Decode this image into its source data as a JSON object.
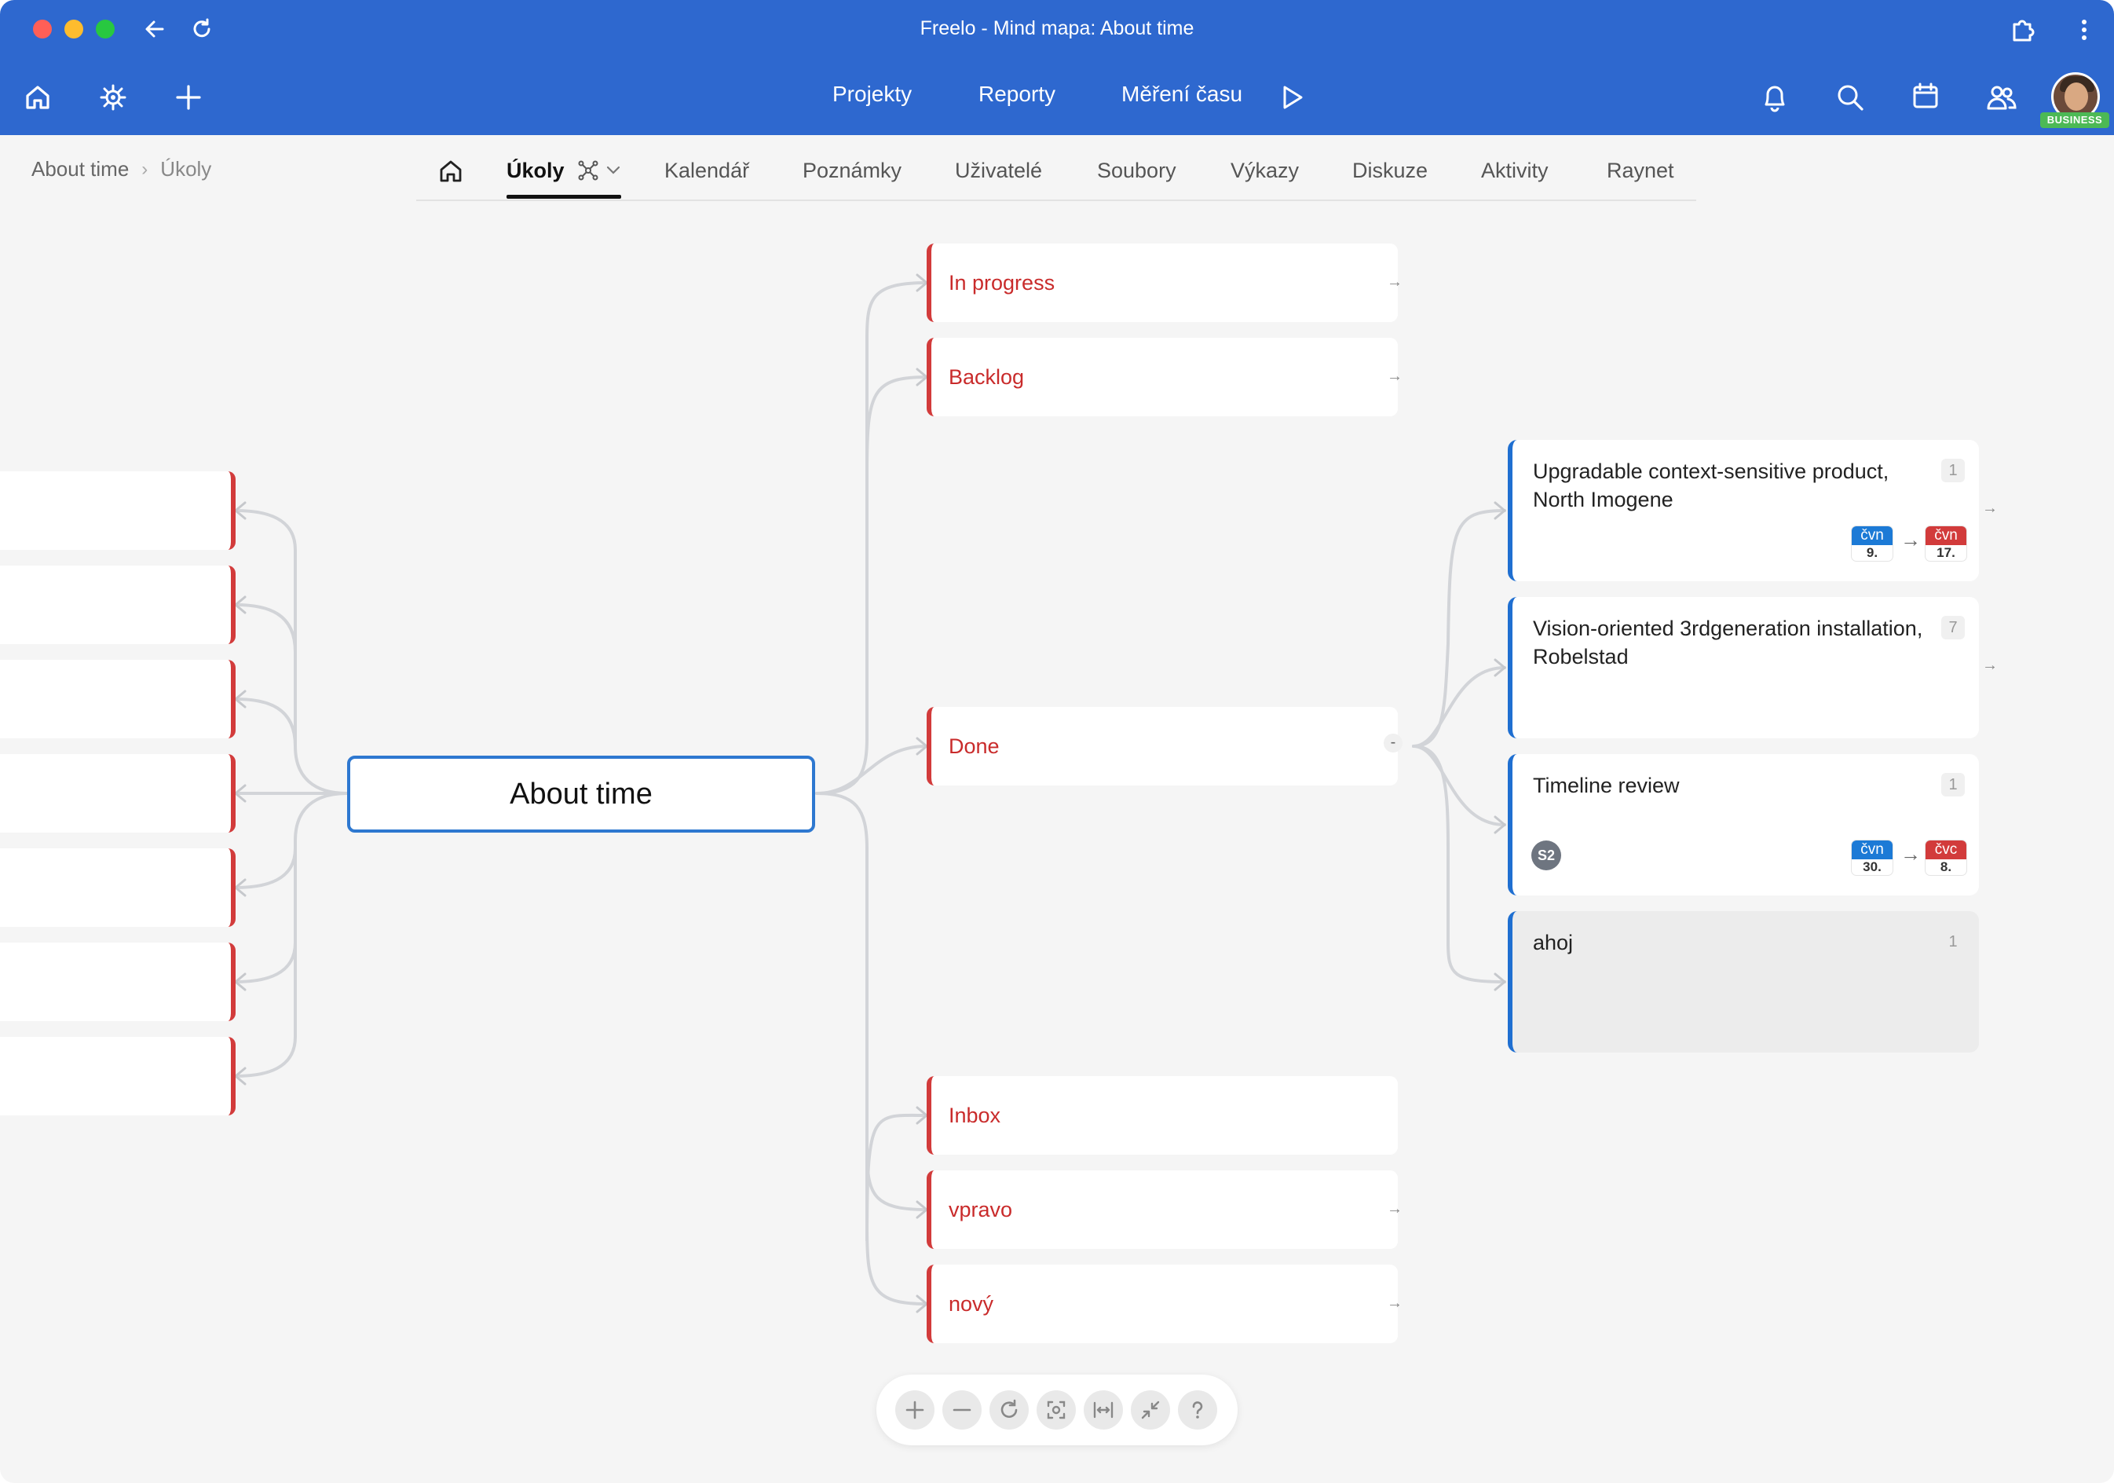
{
  "window": {
    "title": "Freelo - Mind mapa: About time"
  },
  "nav": {
    "projects": "Projekty",
    "reports": "Reporty",
    "time_tracking": "Měření času",
    "plan_badge": "BUSINESS"
  },
  "breadcrumb": {
    "project": "About time",
    "separator": "›",
    "current": "Úkoly"
  },
  "tabs": {
    "tasks": "Úkoly",
    "calendar": "Kalendář",
    "notes": "Poznámky",
    "users": "Uživatelé",
    "files": "Soubory",
    "timesheets": "Výkazy",
    "discussion": "Diskuze",
    "activities": "Aktivity",
    "raynet": "Raynet"
  },
  "mindmap": {
    "root": "About time",
    "columns": {
      "in_progress": "In progress",
      "backlog": "Backlog",
      "done": "Done",
      "inbox": "Inbox",
      "vpravo": "vpravo",
      "novy": "nový"
    },
    "expand_glyph": "→",
    "collapse_glyph": "-",
    "tasks": [
      {
        "title": "Upgradable context-sensitive product, North Imogene",
        "count": "1",
        "start_month": "čvn",
        "start_day": "9.",
        "end_month": "čvn",
        "end_day": "17."
      },
      {
        "title": "Vision-oriented 3rdgeneration installation, Robelstad",
        "count": "7"
      },
      {
        "title": "Timeline review",
        "count": "1",
        "assignee": "S2",
        "start_month": "čvn",
        "start_day": "30.",
        "end_month": "čvc",
        "end_day": "8."
      },
      {
        "title": "ahoj",
        "count": "1"
      }
    ],
    "date_arrow": "→"
  },
  "colors": {
    "header": "#2e68cf",
    "column_accent": "#d23b3b",
    "task_accent": "#1f6fd1",
    "root_border": "#2e78d0"
  }
}
